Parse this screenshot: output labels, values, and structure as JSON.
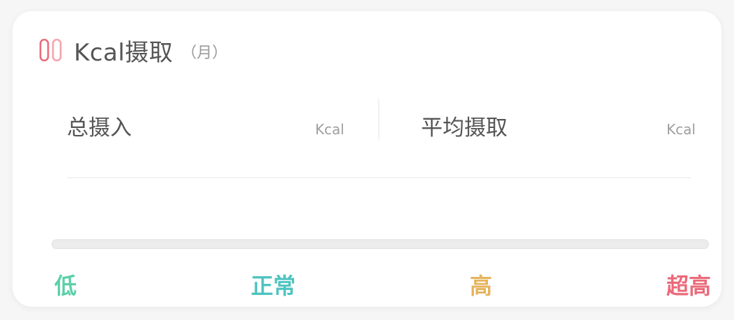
{
  "header": {
    "icon": "bar-chart-icon",
    "title": "Kcal摄取",
    "subtitle": "（月）"
  },
  "stats": {
    "total": {
      "label": "总摄入",
      "unit": "Kcal"
    },
    "average": {
      "label": "平均摄取",
      "unit": "Kcal"
    }
  },
  "progress": {
    "value": 0
  },
  "levels": [
    {
      "label": "低",
      "color": "#5ccfa8"
    },
    {
      "label": "正常",
      "color": "#4fc4c0"
    },
    {
      "label": "高",
      "color": "#e6b35c"
    },
    {
      "label": "超高",
      "color": "#ea6a7a"
    }
  ],
  "colors": {
    "accent_icon_left": "#e86b7b",
    "accent_icon_right": "#f4a3ad"
  }
}
